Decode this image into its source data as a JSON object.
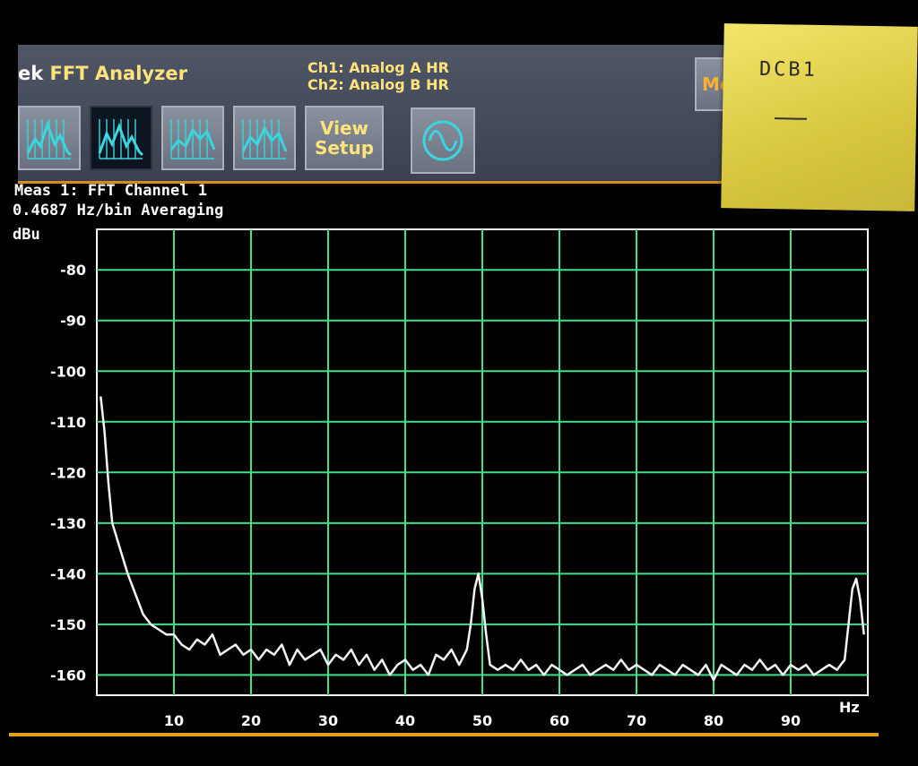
{
  "app": {
    "brand": "ek",
    "title": "FFT Analyzer",
    "channel1": "Ch1: Analog A HR",
    "channel2": "Ch2: Analog B HR"
  },
  "toolbar": {
    "view_setup_line1": "View",
    "view_setup_line2": "Setup",
    "mode_label": "Mo",
    "icon_buttons": [
      "spectrum-icon",
      "spectrum-icon",
      "spectrum-icon",
      "spectrum-icon",
      "sine-wave-icon"
    ]
  },
  "measurement": {
    "title": "Meas 1: FFT Channel 1",
    "resolution": "0.4687 Hz/bin  Averaging",
    "unit": "dBu"
  },
  "sticky_note": {
    "text": "DCB1",
    "mark": "—"
  },
  "colors": {
    "grid": "#3fe08a",
    "trace": "#f4f4f4",
    "toolbar_text": "#ffe37a",
    "accent": "#e0a020"
  },
  "chart_data": {
    "type": "line",
    "title": "",
    "xlabel": "Hz",
    "ylabel": "dBu",
    "xlim": [
      0,
      100
    ],
    "ylim": [
      -164,
      -72
    ],
    "x_ticks": [
      10,
      20,
      30,
      40,
      50,
      60,
      70,
      80,
      90
    ],
    "y_ticks": [
      -80,
      -90,
      -100,
      -110,
      -120,
      -130,
      -140,
      -150,
      -160
    ],
    "grid": true,
    "series": [
      {
        "x": [
          0.5,
          1,
          1.5,
          2,
          3,
          4,
          5,
          6,
          7,
          8,
          9,
          10,
          11,
          12,
          13,
          14,
          15,
          16,
          17,
          18,
          19,
          20,
          21,
          22,
          23,
          24,
          25,
          26,
          27,
          28,
          29,
          30,
          31,
          32,
          33,
          34,
          35,
          36,
          37,
          38,
          39,
          40,
          41,
          42,
          43,
          44,
          45,
          46,
          47,
          48,
          48.5,
          49,
          49.5,
          50,
          50.5,
          51,
          52,
          53,
          54,
          55,
          56,
          57,
          58,
          59,
          60,
          61,
          62,
          63,
          64,
          65,
          66,
          67,
          68,
          69,
          70,
          71,
          72,
          73,
          74,
          75,
          76,
          77,
          78,
          79,
          80,
          81,
          82,
          83,
          84,
          85,
          86,
          87,
          88,
          89,
          90,
          91,
          92,
          93,
          94,
          95,
          96,
          97,
          97.5,
          98,
          98.5,
          99,
          99.5
        ],
        "y": [
          -105,
          -112,
          -122,
          -130,
          -135,
          -140,
          -144,
          -148,
          -150,
          -151,
          -152,
          -152,
          -154,
          -155,
          -153,
          -154,
          -152,
          -156,
          -155,
          -154,
          -156,
          -155,
          -157,
          -155,
          -156,
          -154,
          -158,
          -155,
          -157,
          -156,
          -155,
          -158,
          -156,
          -157,
          -155,
          -158,
          -156,
          -159,
          -157,
          -160,
          -158,
          -157,
          -159,
          -158,
          -160,
          -156,
          -157,
          -155,
          -158,
          -155,
          -150,
          -143,
          -140,
          -145,
          -152,
          -158,
          -159,
          -158,
          -159,
          -157,
          -159,
          -158,
          -160,
          -158,
          -159,
          -160,
          -159,
          -158,
          -160,
          -159,
          -158,
          -159,
          -157,
          -159,
          -158,
          -159,
          -160,
          -158,
          -159,
          -160,
          -158,
          -159,
          -160,
          -158,
          -161,
          -158,
          -159,
          -160,
          -158,
          -159,
          -157,
          -159,
          -158,
          -160,
          -158,
          -159,
          -158,
          -160,
          -159,
          -158,
          -159,
          -157,
          -150,
          -143,
          -141,
          -145,
          -152
        ]
      }
    ]
  }
}
